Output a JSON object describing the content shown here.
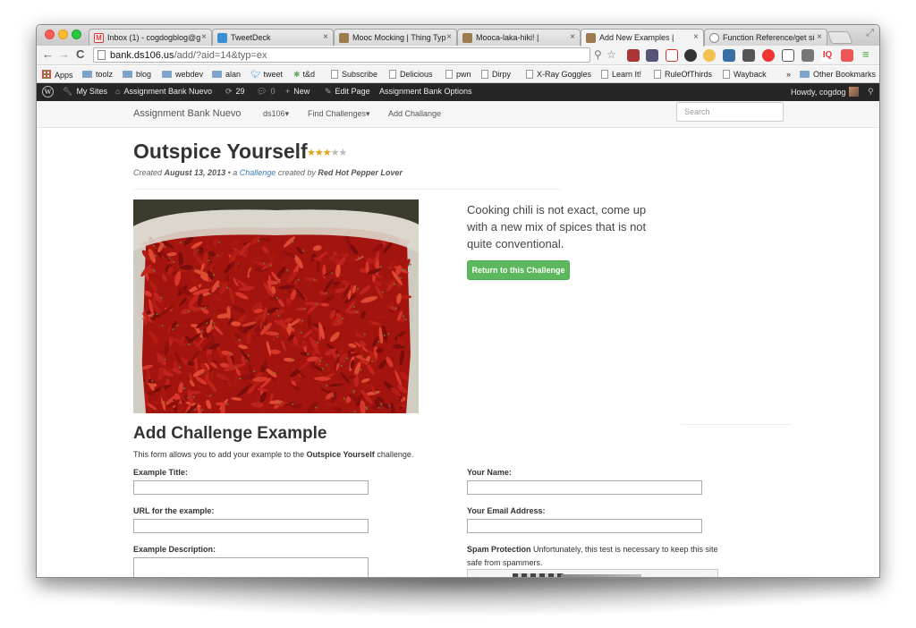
{
  "browser": {
    "tabs": [
      {
        "label": "Inbox (1) - cogdogblog@g",
        "active": false
      },
      {
        "label": "TweetDeck",
        "active": false
      },
      {
        "label": "Mooc Mocking | Thing Typ",
        "active": false
      },
      {
        "label": "Mooca-laka-hiki! |",
        "active": false
      },
      {
        "label": "Add New Examples |",
        "active": true
      },
      {
        "label": "Function Reference/get si",
        "active": false
      }
    ],
    "url_domain": "bank.ds106.us",
    "url_path": "/add/?aid=14&typ=ex",
    "bookmarks": [
      "Apps",
      "toolz",
      "blog",
      "webdev",
      "alan",
      "tweet",
      "t&d",
      "Subscribe",
      "Delicious",
      "pwn",
      "Dirpy",
      "X-Ray Goggles",
      "Learn It!",
      "RuleOfThirds",
      "Wayback",
      "Other Bookmarks"
    ],
    "bookmarks_overflow": "»"
  },
  "adminbar": {
    "my_sites": "My Sites",
    "site_name": "Assignment Bank Nuevo",
    "updates_count": "29",
    "comments_count": "0",
    "new_label": "New",
    "edit_page": "Edit Page",
    "options": "Assignment Bank Options",
    "howdy": "Howdy, cogdog"
  },
  "sitenav": {
    "brand": "Assignment Bank Nuevo",
    "links": [
      "ds106",
      "Find Challenges",
      "Add Challange"
    ],
    "search_placeholder": "Search"
  },
  "challenge": {
    "title": "Outspice Yourself",
    "rating_stars": 3,
    "rating_max": 5,
    "meta_created": "Created",
    "meta_date": "August 13, 2013",
    "meta_sep": "• a",
    "meta_type": "Challenge",
    "meta_by": "created by",
    "meta_author": "Red Hot Pepper Lover",
    "description": "Cooking chili is not exact, come up with a new mix of spices that is not quite conventional.",
    "return_button": "Return to this Challenge"
  },
  "form": {
    "heading": "Add Challenge Example",
    "intro_pre": "This form allows you to add your example to the",
    "intro_name": "Outspice Yourself",
    "intro_post": "challenge.",
    "example_title_label": "Example Title:",
    "url_label": "URL for the example:",
    "description_label": "Example Description:",
    "name_label": "Your Name:",
    "email_label": "Your Email Address:",
    "spam_label": "Spam Protection",
    "spam_text": "Unfortunately, this test is necessary to keep this site safe from spammers."
  },
  "colors": {
    "admin_bar": "#262626",
    "button_green": "#5cb85c",
    "link_blue": "#3a78b5",
    "star": "#e5a114"
  }
}
